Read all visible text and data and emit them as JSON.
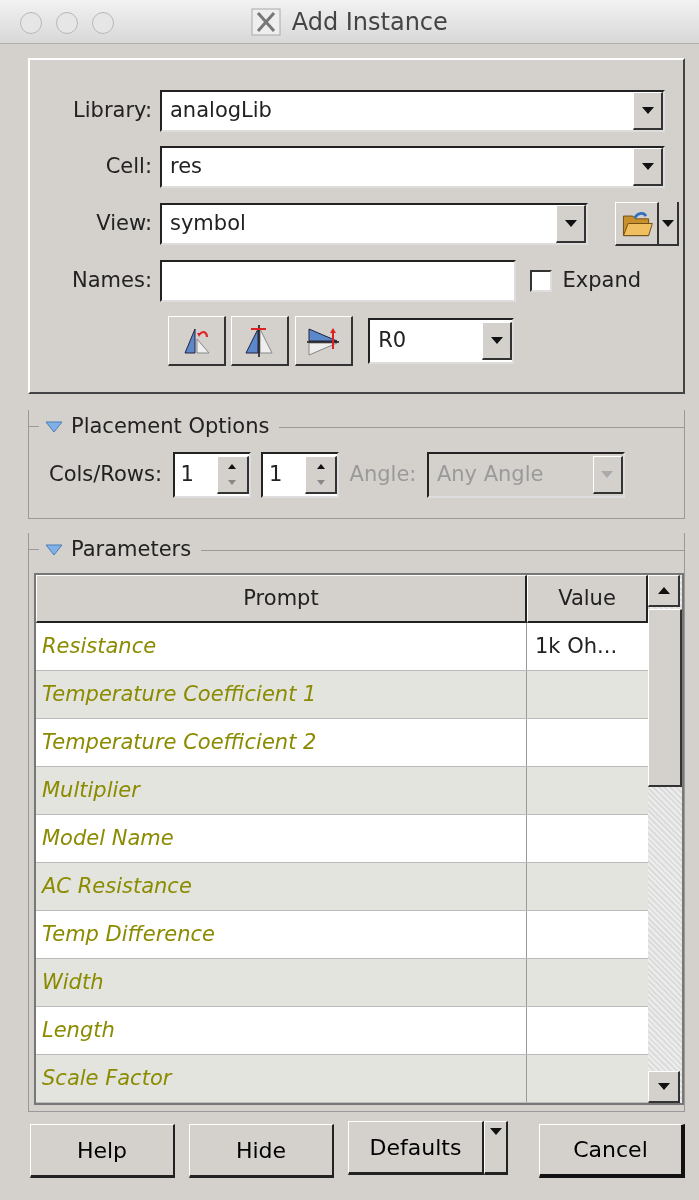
{
  "window": {
    "title": "Add Instance"
  },
  "form": {
    "library": {
      "label": "Library:",
      "value": "analogLib"
    },
    "cell": {
      "label": "Cell:",
      "value": "res"
    },
    "view": {
      "label": "View:",
      "value": "symbol"
    },
    "names": {
      "label": "Names:"
    },
    "expand": {
      "label": "Expand",
      "checked": false
    },
    "rotation": {
      "value": "R0"
    }
  },
  "placement": {
    "title": "Placement Options",
    "expanded": true,
    "cols_rows_label": "Cols/Rows:",
    "cols": "1",
    "rows": "1",
    "angle": {
      "label": "Angle:",
      "value": "Any Angle",
      "disabled": true
    }
  },
  "parameters": {
    "title": "Parameters",
    "expanded": true,
    "columns": [
      "Prompt",
      "Value"
    ],
    "rows": [
      {
        "prompt": "Resistance",
        "value": "1k Oh..."
      },
      {
        "prompt": "Temperature Coefficient 1"
      },
      {
        "prompt": "Temperature Coefficient 2"
      },
      {
        "prompt": "Multiplier"
      },
      {
        "prompt": "Model Name"
      },
      {
        "prompt": "AC Resistance"
      },
      {
        "prompt": "Temp Difference"
      },
      {
        "prompt": "Width"
      },
      {
        "prompt": "Length"
      },
      {
        "prompt": "Scale Factor"
      }
    ]
  },
  "buttons": [
    {
      "label": "Help",
      "kind": "plain"
    },
    {
      "label": "Hide",
      "kind": "plain"
    },
    {
      "label": "Defaults",
      "kind": "split"
    },
    {
      "label": "Cancel",
      "kind": "default"
    }
  ]
}
